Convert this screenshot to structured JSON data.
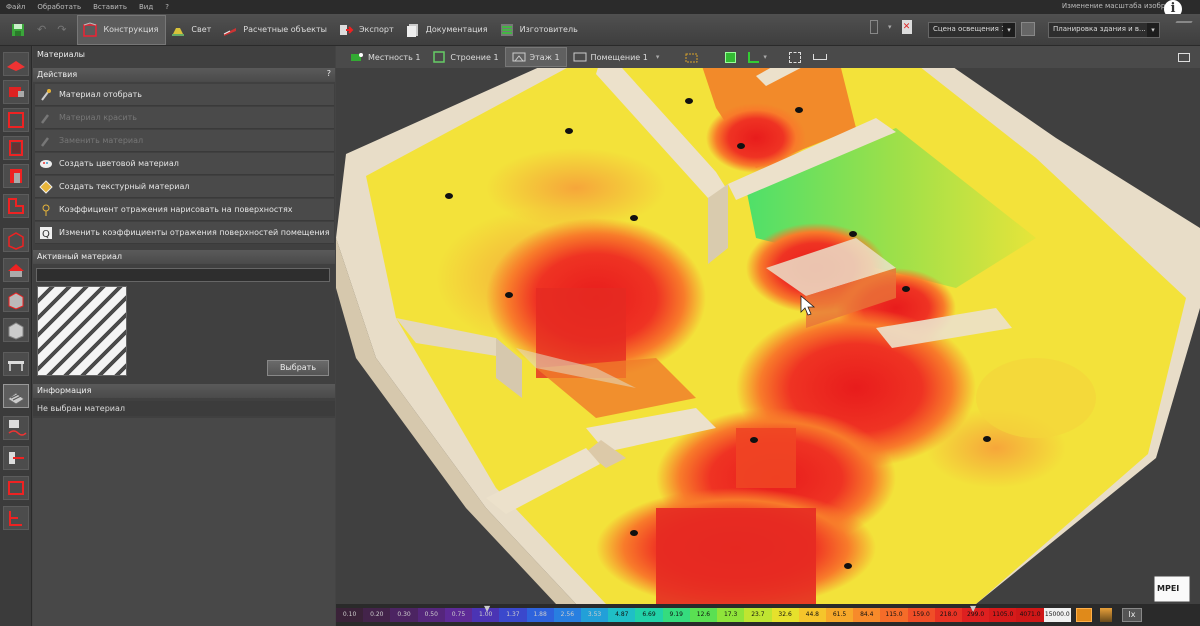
{
  "menu": [
    "Файл",
    "Обработать",
    "Вставить",
    "Вид",
    "?"
  ],
  "help_text": "Изменение масштаба изобр...",
  "info_glyph": "i",
  "ribbon": {
    "tabs": [
      {
        "label": "Конструкция",
        "icon": "construction-icon",
        "active": true
      },
      {
        "label": "Свет",
        "icon": "light-icon"
      },
      {
        "label": "Расчетные объекты",
        "icon": "calc-objects-icon"
      },
      {
        "label": "Экспорт",
        "icon": "export-icon"
      },
      {
        "label": "Документация",
        "icon": "documentation-icon"
      },
      {
        "label": "Изготовитель",
        "icon": "manufacturer-icon"
      }
    ],
    "scene_combo": "Сцена освещения 1",
    "plan_combo": "Планировка здания и в..."
  },
  "panel": {
    "title": "Материалы",
    "actions_header": "Действия",
    "help": "?",
    "actions": [
      {
        "label": "Материал отобрать",
        "enabled": true,
        "icon": "pipette-icon"
      },
      {
        "label": "Материал красить",
        "enabled": false,
        "icon": "brush-icon"
      },
      {
        "label": "Заменить материал",
        "enabled": false,
        "icon": "replace-icon"
      },
      {
        "label": "Создать цветовой материал",
        "enabled": true,
        "icon": "color-material-icon"
      },
      {
        "label": "Создать текстурный материал",
        "enabled": true,
        "icon": "texture-material-icon"
      },
      {
        "label": "Коэффициент отражения нарисовать на поверхностях",
        "enabled": true,
        "icon": "reflectance-paint-icon"
      },
      {
        "label": "Изменить коэффициенты отражения поверхностей помещения",
        "enabled": true,
        "icon": "reflectance-edit-icon"
      }
    ],
    "active_material_header": "Активный материал",
    "select_button": "Выбрать",
    "info_header": "Информация",
    "info_text": "Не выбран материал"
  },
  "view_toolbar": [
    {
      "label": "Местность 1",
      "icon": "terrain-icon"
    },
    {
      "label": "Строение 1",
      "icon": "building-icon"
    },
    {
      "label": "Этаж 1",
      "icon": "floor-icon",
      "active": true
    },
    {
      "label": "Помещение 1",
      "icon": "room-icon"
    }
  ],
  "legend": {
    "values": [
      "0.10",
      "0.20",
      "0.30",
      "0.50",
      "0.75",
      "1.00",
      "1.37",
      "1.88",
      "2.56",
      "3.53",
      "4.87",
      "6.69",
      "9.19",
      "12.6",
      "17.3",
      "23.7",
      "32.6",
      "44.8",
      "61.5",
      "84.4",
      "115.0",
      "159.0",
      "218.0",
      "299.0",
      "1105.0",
      "4071.0",
      "15000.0"
    ],
    "colors": [
      "#3a2238",
      "#43234a",
      "#4c2462",
      "#55267c",
      "#5d2a96",
      "#4b34b4",
      "#3a48cc",
      "#2e63dc",
      "#287fe0",
      "#22a0d8",
      "#1fbfc6",
      "#22d2a8",
      "#35dc7e",
      "#5ae052",
      "#8fe43a",
      "#bfe531",
      "#e6e12c",
      "#f5c52b",
      "#f7a82a",
      "#f78a2a",
      "#f56c29",
      "#f04e27",
      "#e83324",
      "#de2020",
      "#d61a1a",
      "#cf1717",
      "#f0f0f0"
    ],
    "unit": "lx",
    "brand": "MPEI"
  }
}
